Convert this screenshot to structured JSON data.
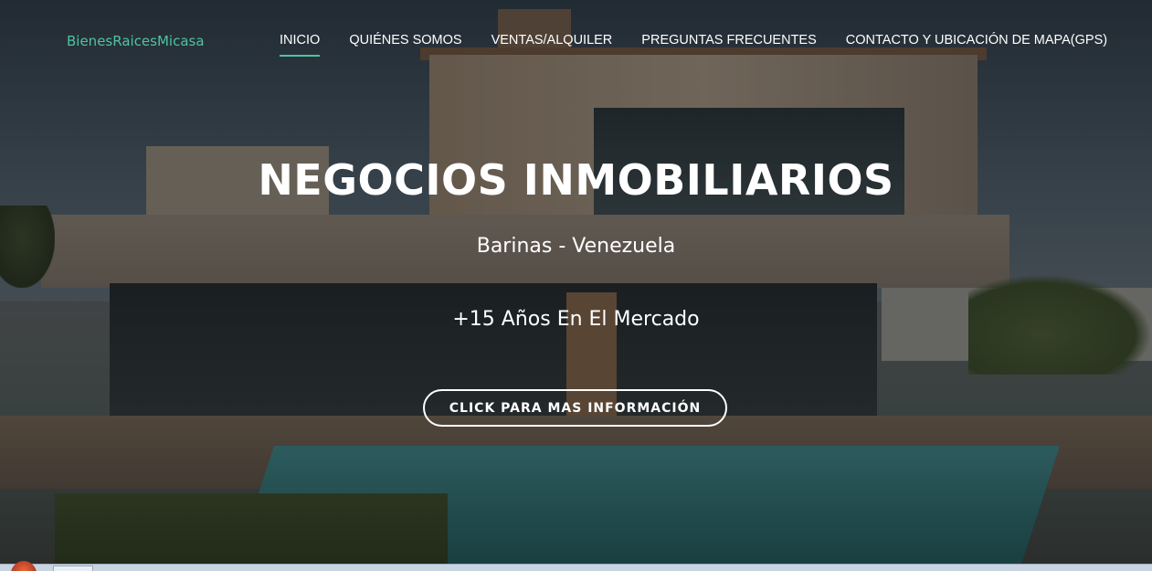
{
  "nav": {
    "brand": "BienesRaicesMicasa",
    "items": [
      {
        "label": "INICIO",
        "active": true
      },
      {
        "label": "QUIÉNES SOMOS",
        "active": false
      },
      {
        "label": "VENTAS/ALQUILER",
        "active": false
      },
      {
        "label": "PREGUNTAS FRECUENTES",
        "active": false
      },
      {
        "label": "CONTACTO Y UBICACIÓN DE MAPA(GPS)",
        "active": false
      }
    ]
  },
  "hero": {
    "title": "NEGOCIOS INMOBILIARIOS",
    "location": "Barinas - Venezuela",
    "tagline": "+15 Años En El Mercado",
    "cta_label": "CLICK PARA MAS INFORMACIÓN"
  },
  "colors": {
    "accent": "#4fc3a1",
    "text": "#ffffff"
  }
}
